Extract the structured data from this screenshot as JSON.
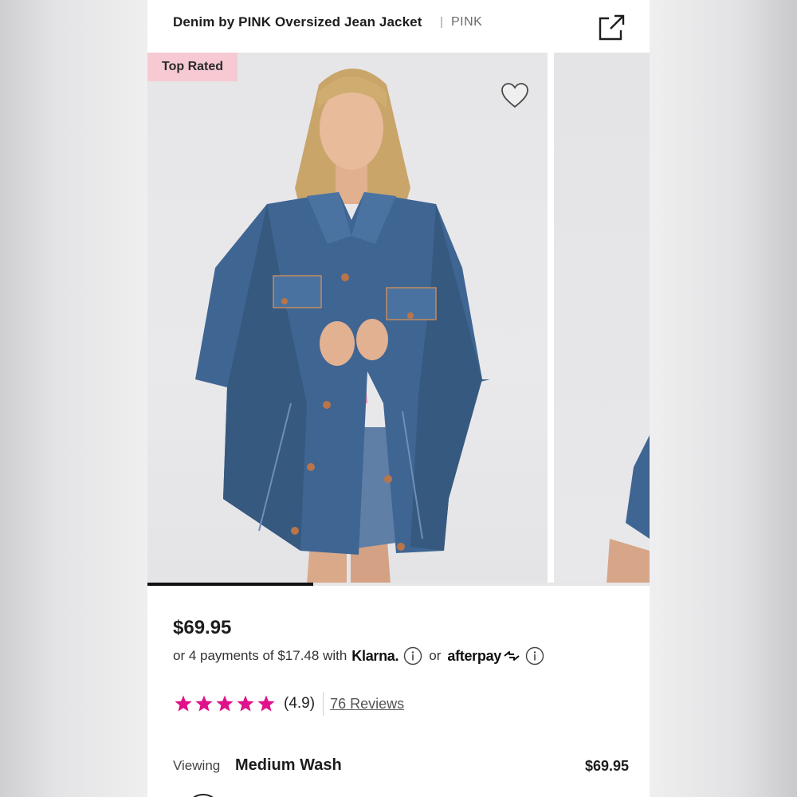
{
  "header": {
    "title": "Denim by PINK Oversized Jean Jacket",
    "separator": "|",
    "brand": "PINK",
    "share_icon": "share-icon"
  },
  "gallery": {
    "badge": "Top Rated",
    "favorite_icon": "heart-outline-icon",
    "progress_fraction": 0.33
  },
  "product": {
    "price": "$69.95",
    "payments_prefix": "or 4 payments of $17.48 with",
    "klarna": "Klarna.",
    "or": "or",
    "afterpay": "afterpay",
    "rating_stars": 5,
    "rating_value": "(4.9)",
    "reviews": "76 Reviews",
    "star_color": "#e0118a"
  },
  "variant": {
    "viewing_label": "Viewing",
    "viewing_value": "Medium Wash",
    "viewing_price": "$69.95"
  }
}
